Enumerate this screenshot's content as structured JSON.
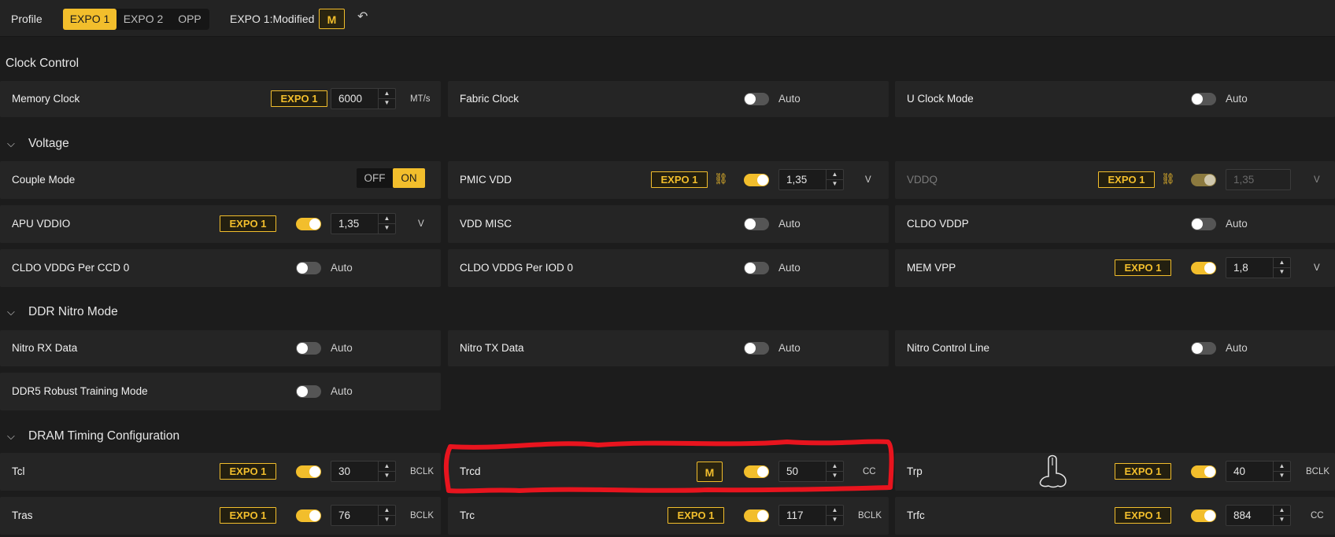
{
  "profile": {
    "label": "Profile",
    "options": [
      "EXPO 1",
      "EXPO 2",
      "OPP"
    ],
    "selected": "EXPO 1",
    "status": "EXPO 1:Modified",
    "modified_badge": "M"
  },
  "sections": {
    "clock_control": "Clock Control",
    "voltage": "Voltage",
    "ddr_nitro": "DDR Nitro Mode",
    "dram_timing": "DRAM Timing Configuration"
  },
  "clock": {
    "memory_clock": {
      "label": "Memory Clock",
      "badge": "EXPO 1",
      "value": "6000",
      "unit": "MT/s"
    },
    "fabric_clock": {
      "label": "Fabric Clock",
      "state": "Auto"
    },
    "uclock_mode": {
      "label": "U Clock Mode",
      "state": "Auto"
    }
  },
  "voltage": {
    "couple_mode": {
      "label": "Couple Mode",
      "off": "OFF",
      "on": "ON"
    },
    "pmic_vdd": {
      "label": "PMIC VDD",
      "badge": "EXPO 1",
      "value": "1,35",
      "unit": "V"
    },
    "vddq": {
      "label": "VDDQ",
      "badge": "EXPO 1",
      "value": "1,35",
      "unit": "V"
    },
    "apu_vddio": {
      "label": "APU VDDIO",
      "badge": "EXPO 1",
      "value": "1,35",
      "unit": "V"
    },
    "vdd_misc": {
      "label": "VDD MISC",
      "state": "Auto"
    },
    "cldo_vddp": {
      "label": "CLDO VDDP",
      "state": "Auto"
    },
    "cldo_vddg_ccd": {
      "label": "CLDO VDDG Per CCD 0",
      "state": "Auto"
    },
    "cldo_vddg_iod": {
      "label": "CLDO VDDG Per IOD 0",
      "state": "Auto"
    },
    "mem_vpp": {
      "label": "MEM VPP",
      "badge": "EXPO 1",
      "value": "1,8",
      "unit": "V"
    }
  },
  "nitro": {
    "rx_data": {
      "label": "Nitro RX Data",
      "state": "Auto"
    },
    "tx_data": {
      "label": "Nitro TX Data",
      "state": "Auto"
    },
    "control_line": {
      "label": "Nitro Control Line",
      "state": "Auto"
    },
    "robust_training": {
      "label": "DDR5 Robust Training Mode",
      "state": "Auto"
    }
  },
  "timing": {
    "tcl": {
      "label": "Tcl",
      "badge": "EXPO 1",
      "value": "30",
      "unit": "BCLK"
    },
    "trcd": {
      "label": "Trcd",
      "badge": "M",
      "value": "50",
      "unit": "CC"
    },
    "trp": {
      "label": "Trp",
      "badge": "EXPO 1",
      "value": "40",
      "unit": "BCLK"
    },
    "tras": {
      "label": "Tras",
      "badge": "EXPO 1",
      "value": "76",
      "unit": "BCLK"
    },
    "trc": {
      "label": "Trc",
      "badge": "EXPO 1",
      "value": "117",
      "unit": "BCLK"
    },
    "trfc": {
      "label": "Trfc",
      "badge": "EXPO 1",
      "value": "884",
      "unit": "CC"
    }
  },
  "colors": {
    "accent": "#f2be2c",
    "annotation": "#e8141e",
    "background": "#1c1c1c",
    "card": "#252525"
  }
}
